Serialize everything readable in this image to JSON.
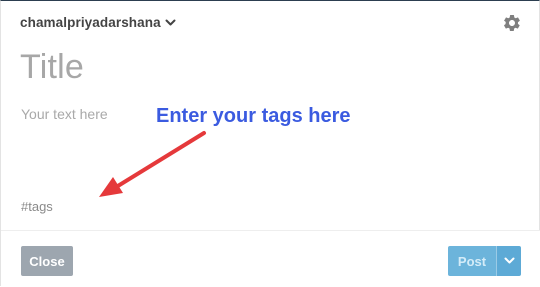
{
  "header": {
    "blog_name": "chamalpriyadarshana",
    "blog_menu_icon": "chevron-down-icon",
    "settings_icon": "gear-icon"
  },
  "editor": {
    "title_placeholder": "Title",
    "body_placeholder": "Your text here",
    "tags_placeholder": "#tags"
  },
  "annotation": {
    "text": "Enter your tags here",
    "color": "#3b5be0",
    "arrow_color": "#e5393b"
  },
  "footer": {
    "close_label": "Close",
    "post_label": "Post",
    "post_menu_icon": "chevron-down-icon"
  },
  "colors": {
    "post_button": "#6cb4db",
    "close_button": "#9da6af"
  }
}
